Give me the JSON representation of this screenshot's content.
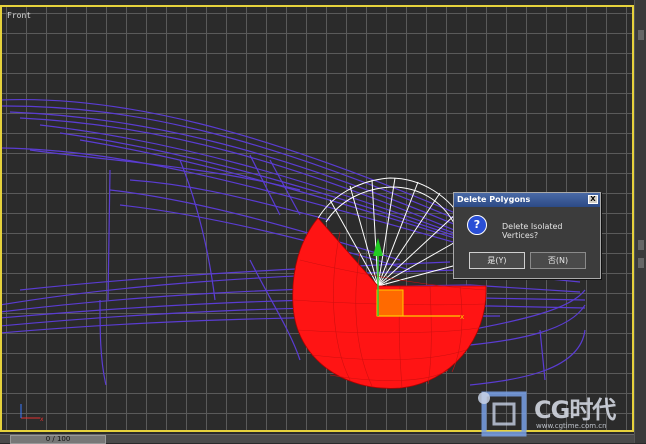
{
  "viewport": {
    "label": "Front"
  },
  "dialog": {
    "title": "Delete Polygons",
    "close_label": "X",
    "icon": "question-icon",
    "message": "Delete Isolated Vertices?",
    "yes_label": "是(Y)",
    "no_label": "否(N)"
  },
  "time_slider": {
    "label": "0 / 100"
  },
  "watermark": {
    "text": "CG时代",
    "url": "www.cgtime.com.cn"
  },
  "colors": {
    "viewport_border": "#e6d23c",
    "wireframe": "#5a3cd2",
    "selection": "#ff1a1a",
    "dialog_title": "#2c4a86"
  }
}
